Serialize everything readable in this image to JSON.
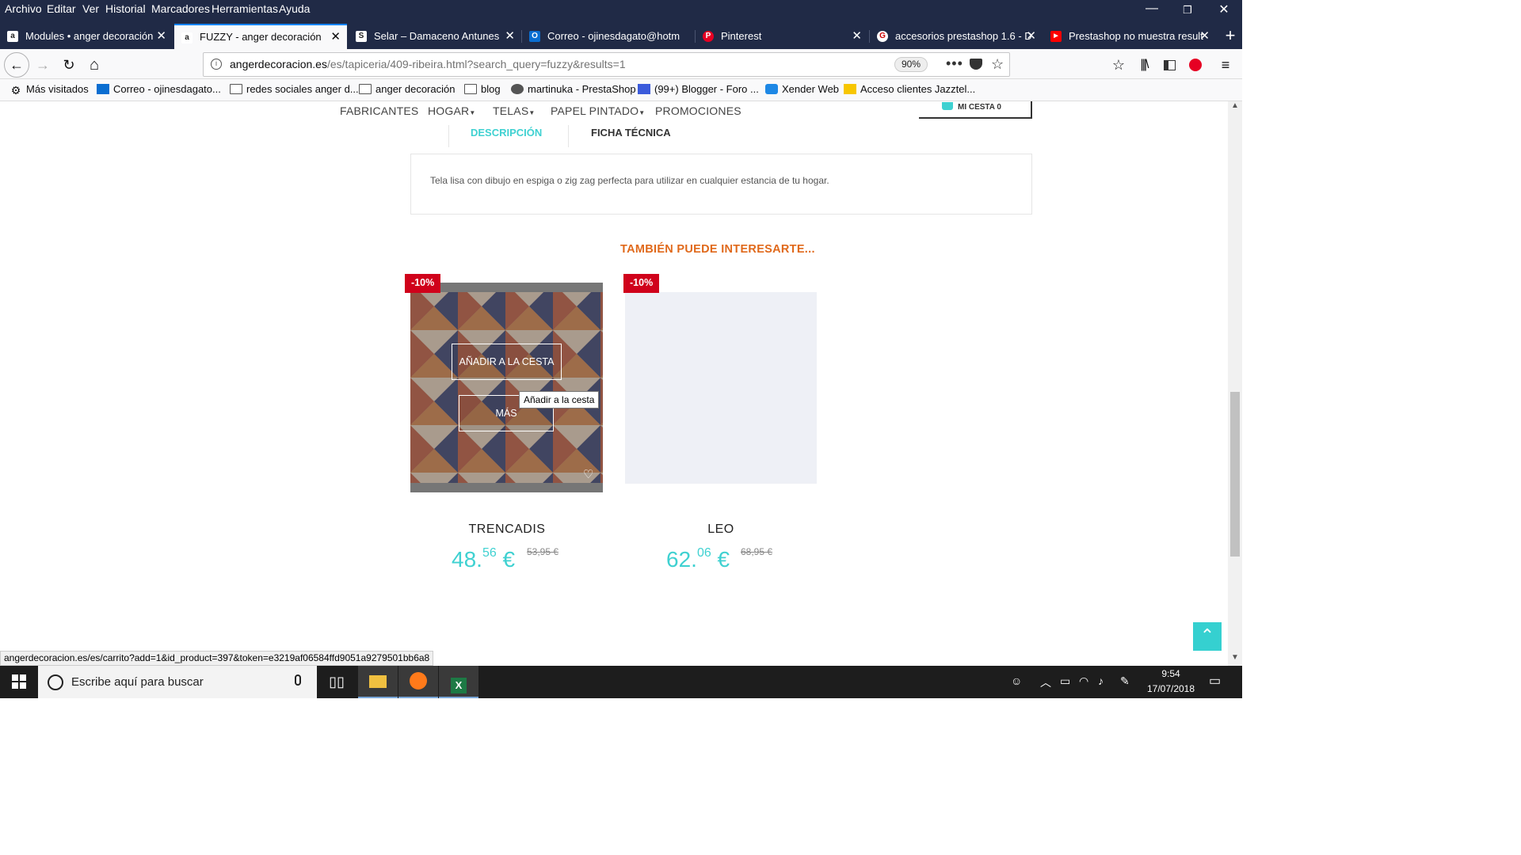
{
  "menu": [
    "Archivo",
    "Editar",
    "Ver",
    "Historial",
    "Marcadores",
    "Herramientas",
    "Ayuda"
  ],
  "window_controls": {
    "minimize": "—",
    "restore": "❐",
    "close": "✕"
  },
  "tabs": [
    {
      "label": "Modules • anger decoración",
      "favicon": "a",
      "active": false
    },
    {
      "label": "FUZZY - anger decoración",
      "favicon": "a",
      "active": true
    },
    {
      "label": "Selar – Damaceno Antunes",
      "favicon": "S",
      "active": false
    },
    {
      "label": "Correo - ojinesdagato@hotm",
      "favicon": "O",
      "active": false
    },
    {
      "label": "Pinterest",
      "favicon": "P",
      "active": false
    },
    {
      "label": "accesorios prestashop 1.6 - D",
      "favicon": "G",
      "active": false
    },
    {
      "label": "Prestashop no muestra result",
      "favicon": "▶",
      "active": false
    }
  ],
  "tab_close_glyph": "✕",
  "new_tab_glyph": "+",
  "nav": {
    "back": "←",
    "forward": "→",
    "reload": "↻",
    "home": "⌂"
  },
  "url": {
    "host": "angerdecoracion.es",
    "path": "/es/tapiceria/409-ribeira.html?search_query=fuzzy&results=1",
    "zoom": "90%"
  },
  "bookmarks": [
    {
      "label": "Más visitados",
      "icon": "gear-icon"
    },
    {
      "label": "Correo - ojinesdagato...",
      "icon": "outlook-icon"
    },
    {
      "label": "redes sociales anger d...",
      "icon": "folder-icon"
    },
    {
      "label": "anger decoración",
      "icon": "folder-icon"
    },
    {
      "label": "blog",
      "icon": "folder-icon"
    },
    {
      "label": "martinuka - PrestaShop",
      "icon": "prestashop-icon"
    },
    {
      "label": "(99+) Blogger - Foro ...",
      "icon": "blogger-icon"
    },
    {
      "label": "Xender Web",
      "icon": "xender-icon"
    },
    {
      "label": "Acceso clientes Jazztel...",
      "icon": "jazztel-icon"
    }
  ],
  "site_nav": [
    {
      "label": "FABRICANTES"
    },
    {
      "label": "HOGAR",
      "dropdown": true
    },
    {
      "label": "TELAS",
      "dropdown": true
    },
    {
      "label": "PAPEL PINTADO",
      "dropdown": true
    },
    {
      "label": "PROMOCIONES"
    }
  ],
  "cart_label": "MI CESTA 0",
  "product_tabs": {
    "description": "DESCRIPCIÓN",
    "specs": "FICHA TÉCNICA"
  },
  "description_text": "Tela lisa con dibujo en espiga o zig zag perfecta para utilizar en cualquier estancia de tu hogar.",
  "related_title": "TAMBIÉN PUEDE INTERESARTE...",
  "products": [
    {
      "badge": "-10%",
      "name": "TRENCADIS",
      "price_int": "48.",
      "price_dec": "56",
      "currency": "€",
      "old_price": "53,95 €",
      "add_to_cart": "AÑADIR A LA CESTA",
      "more": "MÁS",
      "tooltip": "Añadir a la cesta"
    },
    {
      "badge": "-10%",
      "name": "LEO",
      "price_int": "62.",
      "price_dec": "06",
      "currency": "€",
      "old_price": "68,95 €"
    }
  ],
  "back_to_top_glyph": "⌃",
  "status_url": "angerdecoracion.es/es/carrito?add=1&id_product=397&token=e3219af06584ffd9051a9279501bb6a8",
  "taskbar": {
    "search_placeholder": "Escribe aquí para buscar",
    "time": "9:54",
    "date": "17/07/2018"
  }
}
